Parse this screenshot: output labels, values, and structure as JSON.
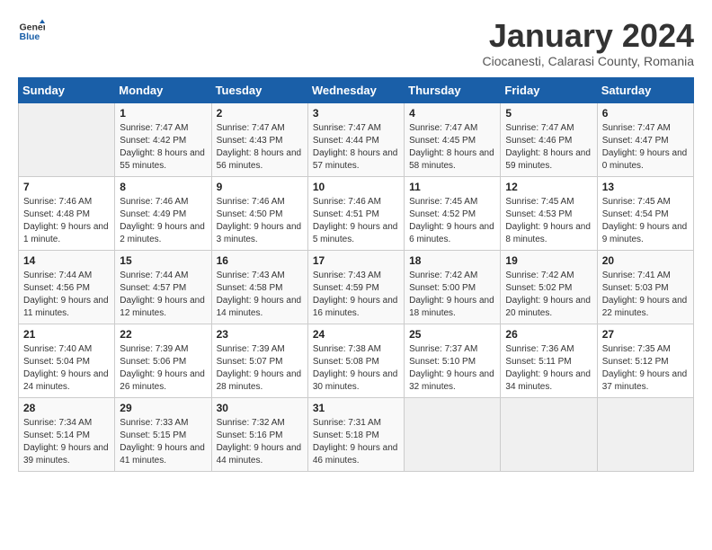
{
  "logo": {
    "line1": "General",
    "line2": "Blue"
  },
  "title": "January 2024",
  "subtitle": "Ciocanesti, Calarasi County, Romania",
  "days_of_week": [
    "Sunday",
    "Monday",
    "Tuesday",
    "Wednesday",
    "Thursday",
    "Friday",
    "Saturday"
  ],
  "weeks": [
    [
      {
        "day": "",
        "sunrise": "",
        "sunset": "",
        "daylight": ""
      },
      {
        "day": "1",
        "sunrise": "Sunrise: 7:47 AM",
        "sunset": "Sunset: 4:42 PM",
        "daylight": "Daylight: 8 hours and 55 minutes."
      },
      {
        "day": "2",
        "sunrise": "Sunrise: 7:47 AM",
        "sunset": "Sunset: 4:43 PM",
        "daylight": "Daylight: 8 hours and 56 minutes."
      },
      {
        "day": "3",
        "sunrise": "Sunrise: 7:47 AM",
        "sunset": "Sunset: 4:44 PM",
        "daylight": "Daylight: 8 hours and 57 minutes."
      },
      {
        "day": "4",
        "sunrise": "Sunrise: 7:47 AM",
        "sunset": "Sunset: 4:45 PM",
        "daylight": "Daylight: 8 hours and 58 minutes."
      },
      {
        "day": "5",
        "sunrise": "Sunrise: 7:47 AM",
        "sunset": "Sunset: 4:46 PM",
        "daylight": "Daylight: 8 hours and 59 minutes."
      },
      {
        "day": "6",
        "sunrise": "Sunrise: 7:47 AM",
        "sunset": "Sunset: 4:47 PM",
        "daylight": "Daylight: 9 hours and 0 minutes."
      }
    ],
    [
      {
        "day": "7",
        "sunrise": "Sunrise: 7:46 AM",
        "sunset": "Sunset: 4:48 PM",
        "daylight": "Daylight: 9 hours and 1 minute."
      },
      {
        "day": "8",
        "sunrise": "Sunrise: 7:46 AM",
        "sunset": "Sunset: 4:49 PM",
        "daylight": "Daylight: 9 hours and 2 minutes."
      },
      {
        "day": "9",
        "sunrise": "Sunrise: 7:46 AM",
        "sunset": "Sunset: 4:50 PM",
        "daylight": "Daylight: 9 hours and 3 minutes."
      },
      {
        "day": "10",
        "sunrise": "Sunrise: 7:46 AM",
        "sunset": "Sunset: 4:51 PM",
        "daylight": "Daylight: 9 hours and 5 minutes."
      },
      {
        "day": "11",
        "sunrise": "Sunrise: 7:45 AM",
        "sunset": "Sunset: 4:52 PM",
        "daylight": "Daylight: 9 hours and 6 minutes."
      },
      {
        "day": "12",
        "sunrise": "Sunrise: 7:45 AM",
        "sunset": "Sunset: 4:53 PM",
        "daylight": "Daylight: 9 hours and 8 minutes."
      },
      {
        "day": "13",
        "sunrise": "Sunrise: 7:45 AM",
        "sunset": "Sunset: 4:54 PM",
        "daylight": "Daylight: 9 hours and 9 minutes."
      }
    ],
    [
      {
        "day": "14",
        "sunrise": "Sunrise: 7:44 AM",
        "sunset": "Sunset: 4:56 PM",
        "daylight": "Daylight: 9 hours and 11 minutes."
      },
      {
        "day": "15",
        "sunrise": "Sunrise: 7:44 AM",
        "sunset": "Sunset: 4:57 PM",
        "daylight": "Daylight: 9 hours and 12 minutes."
      },
      {
        "day": "16",
        "sunrise": "Sunrise: 7:43 AM",
        "sunset": "Sunset: 4:58 PM",
        "daylight": "Daylight: 9 hours and 14 minutes."
      },
      {
        "day": "17",
        "sunrise": "Sunrise: 7:43 AM",
        "sunset": "Sunset: 4:59 PM",
        "daylight": "Daylight: 9 hours and 16 minutes."
      },
      {
        "day": "18",
        "sunrise": "Sunrise: 7:42 AM",
        "sunset": "Sunset: 5:00 PM",
        "daylight": "Daylight: 9 hours and 18 minutes."
      },
      {
        "day": "19",
        "sunrise": "Sunrise: 7:42 AM",
        "sunset": "Sunset: 5:02 PM",
        "daylight": "Daylight: 9 hours and 20 minutes."
      },
      {
        "day": "20",
        "sunrise": "Sunrise: 7:41 AM",
        "sunset": "Sunset: 5:03 PM",
        "daylight": "Daylight: 9 hours and 22 minutes."
      }
    ],
    [
      {
        "day": "21",
        "sunrise": "Sunrise: 7:40 AM",
        "sunset": "Sunset: 5:04 PM",
        "daylight": "Daylight: 9 hours and 24 minutes."
      },
      {
        "day": "22",
        "sunrise": "Sunrise: 7:39 AM",
        "sunset": "Sunset: 5:06 PM",
        "daylight": "Daylight: 9 hours and 26 minutes."
      },
      {
        "day": "23",
        "sunrise": "Sunrise: 7:39 AM",
        "sunset": "Sunset: 5:07 PM",
        "daylight": "Daylight: 9 hours and 28 minutes."
      },
      {
        "day": "24",
        "sunrise": "Sunrise: 7:38 AM",
        "sunset": "Sunset: 5:08 PM",
        "daylight": "Daylight: 9 hours and 30 minutes."
      },
      {
        "day": "25",
        "sunrise": "Sunrise: 7:37 AM",
        "sunset": "Sunset: 5:10 PM",
        "daylight": "Daylight: 9 hours and 32 minutes."
      },
      {
        "day": "26",
        "sunrise": "Sunrise: 7:36 AM",
        "sunset": "Sunset: 5:11 PM",
        "daylight": "Daylight: 9 hours and 34 minutes."
      },
      {
        "day": "27",
        "sunrise": "Sunrise: 7:35 AM",
        "sunset": "Sunset: 5:12 PM",
        "daylight": "Daylight: 9 hours and 37 minutes."
      }
    ],
    [
      {
        "day": "28",
        "sunrise": "Sunrise: 7:34 AM",
        "sunset": "Sunset: 5:14 PM",
        "daylight": "Daylight: 9 hours and 39 minutes."
      },
      {
        "day": "29",
        "sunrise": "Sunrise: 7:33 AM",
        "sunset": "Sunset: 5:15 PM",
        "daylight": "Daylight: 9 hours and 41 minutes."
      },
      {
        "day": "30",
        "sunrise": "Sunrise: 7:32 AM",
        "sunset": "Sunset: 5:16 PM",
        "daylight": "Daylight: 9 hours and 44 minutes."
      },
      {
        "day": "31",
        "sunrise": "Sunrise: 7:31 AM",
        "sunset": "Sunset: 5:18 PM",
        "daylight": "Daylight: 9 hours and 46 minutes."
      },
      {
        "day": "",
        "sunrise": "",
        "sunset": "",
        "daylight": ""
      },
      {
        "day": "",
        "sunrise": "",
        "sunset": "",
        "daylight": ""
      },
      {
        "day": "",
        "sunrise": "",
        "sunset": "",
        "daylight": ""
      }
    ]
  ]
}
